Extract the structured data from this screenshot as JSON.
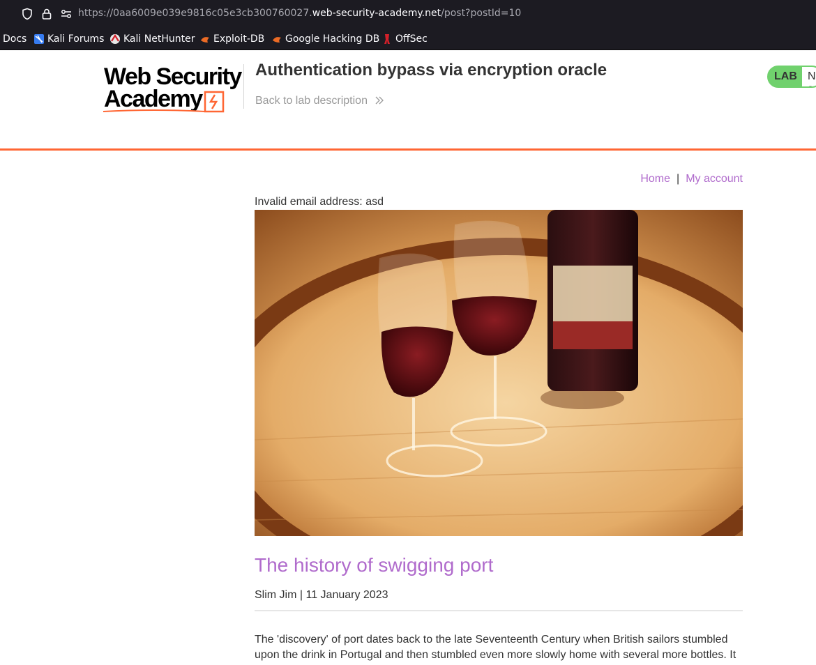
{
  "browser": {
    "url_prefix": "https://0aa6009e039e9816c05e3cb300760027.",
    "url_host": "web-security-academy.net",
    "url_path": "/post?postId=10",
    "bookmarks": [
      {
        "label": "Docs",
        "icon": "none"
      },
      {
        "label": "Kali Forums",
        "icon": "kali-forums-icon"
      },
      {
        "label": "Kali NetHunter",
        "icon": "nethunter-icon"
      },
      {
        "label": "Exploit-DB",
        "icon": "exploit-db-icon"
      },
      {
        "label": "Google Hacking DB",
        "icon": "ghdb-icon"
      },
      {
        "label": "OffSec",
        "icon": "offsec-icon"
      }
    ]
  },
  "lab_header": {
    "logo_line1": "Web Security",
    "logo_line2": "Academy",
    "title": "Authentication bypass via encryption oracle",
    "back_link": "Back to lab description",
    "badge_label": "LAB",
    "badge_status": "Not solved",
    "accent_color": "#ff6633",
    "badge_color": "#70d16d"
  },
  "nav": {
    "home": "Home",
    "separator": "|",
    "account": "My account"
  },
  "notice": "Invalid email address: asd",
  "post": {
    "image_alt": "Two glasses of port wine and a bottle on a wooden barrel",
    "title": "The history of swigging port",
    "byline": "Slim Jim | 11 January 2023",
    "body": "The 'discovery' of port dates back to the late Seventeenth Century when British sailors stumbled upon the drink in Portugal and then stumbled even more slowly home with several more bottles. It",
    "link_color": "#b06bcc"
  }
}
